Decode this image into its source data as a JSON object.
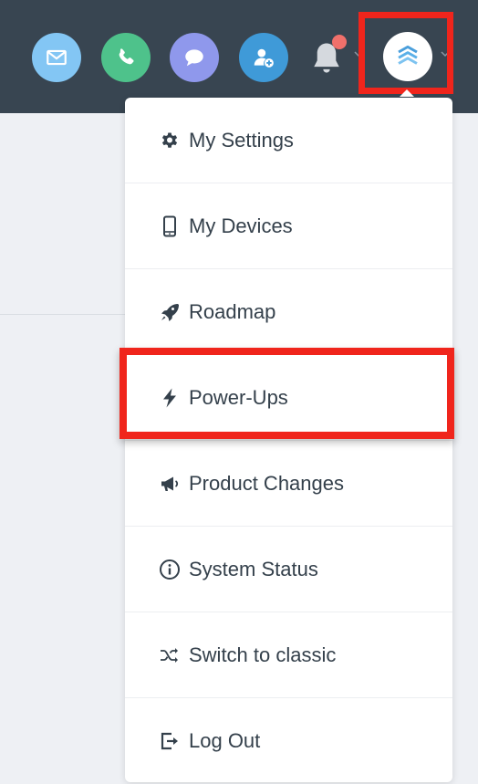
{
  "header": {
    "buttons": [
      {
        "icon": "email-icon",
        "color": "#83c6f4"
      },
      {
        "icon": "phone-icon",
        "color": "#4ec28b"
      },
      {
        "icon": "chat-icon",
        "color": "#8f98ec"
      },
      {
        "icon": "add-contact-icon",
        "color": "#3f9ad8"
      }
    ],
    "notification_icon": "bell-icon",
    "notification_dot_color": "#f0706b",
    "avatar_icon": "stacked-chevrons-logo-icon",
    "highlight_color": "#f0251c",
    "background_color": "#384551"
  },
  "menu": {
    "items": [
      {
        "label": "My Settings",
        "icon": "gear-icon"
      },
      {
        "label": "My Devices",
        "icon": "phone-device-icon"
      },
      {
        "label": "Roadmap",
        "icon": "rocket-icon"
      },
      {
        "label": "Power-Ups",
        "icon": "lightning-bolt-icon"
      },
      {
        "label": "Product Changes",
        "icon": "megaphone-icon"
      },
      {
        "label": "System Status",
        "icon": "info-circle-icon"
      },
      {
        "label": "Switch to classic",
        "icon": "shuffle-icon"
      },
      {
        "label": "Log Out",
        "icon": "logout-icon"
      }
    ],
    "highlighted_item": "Power-Ups"
  }
}
